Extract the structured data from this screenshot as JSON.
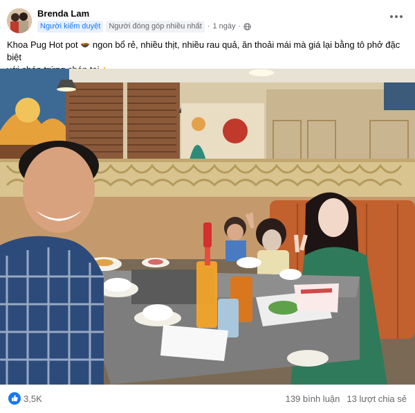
{
  "post": {
    "author": "Brenda Lam",
    "badges": [
      "Người kiểm duyệt",
      "Người đóng góp nhiều nhất"
    ],
    "separator": "·",
    "time": "1 ngày",
    "text_line1": "Khoa Pug Hot pot",
    "text_line1_rest": " ngon bổ rẻ, nhiều thịt, nhiều rau quả, ăn thoải mái mà giá lại bằng tô phở đặc biệt",
    "text_line2": "với chén trứng chén tai",
    "text_line2_end": "."
  },
  "footer": {
    "reaction_count": "3,5K",
    "comments": "139 bình luận",
    "shares": "13 lượt chia sẻ"
  },
  "colors": {
    "accent": "#1877f2",
    "secondary_text": "#65676b"
  },
  "icons": [
    "hotpot-emoji-icon",
    "thumbs-up-emoji-icon",
    "globe-icon",
    "more-icon",
    "like-reaction-icon"
  ]
}
